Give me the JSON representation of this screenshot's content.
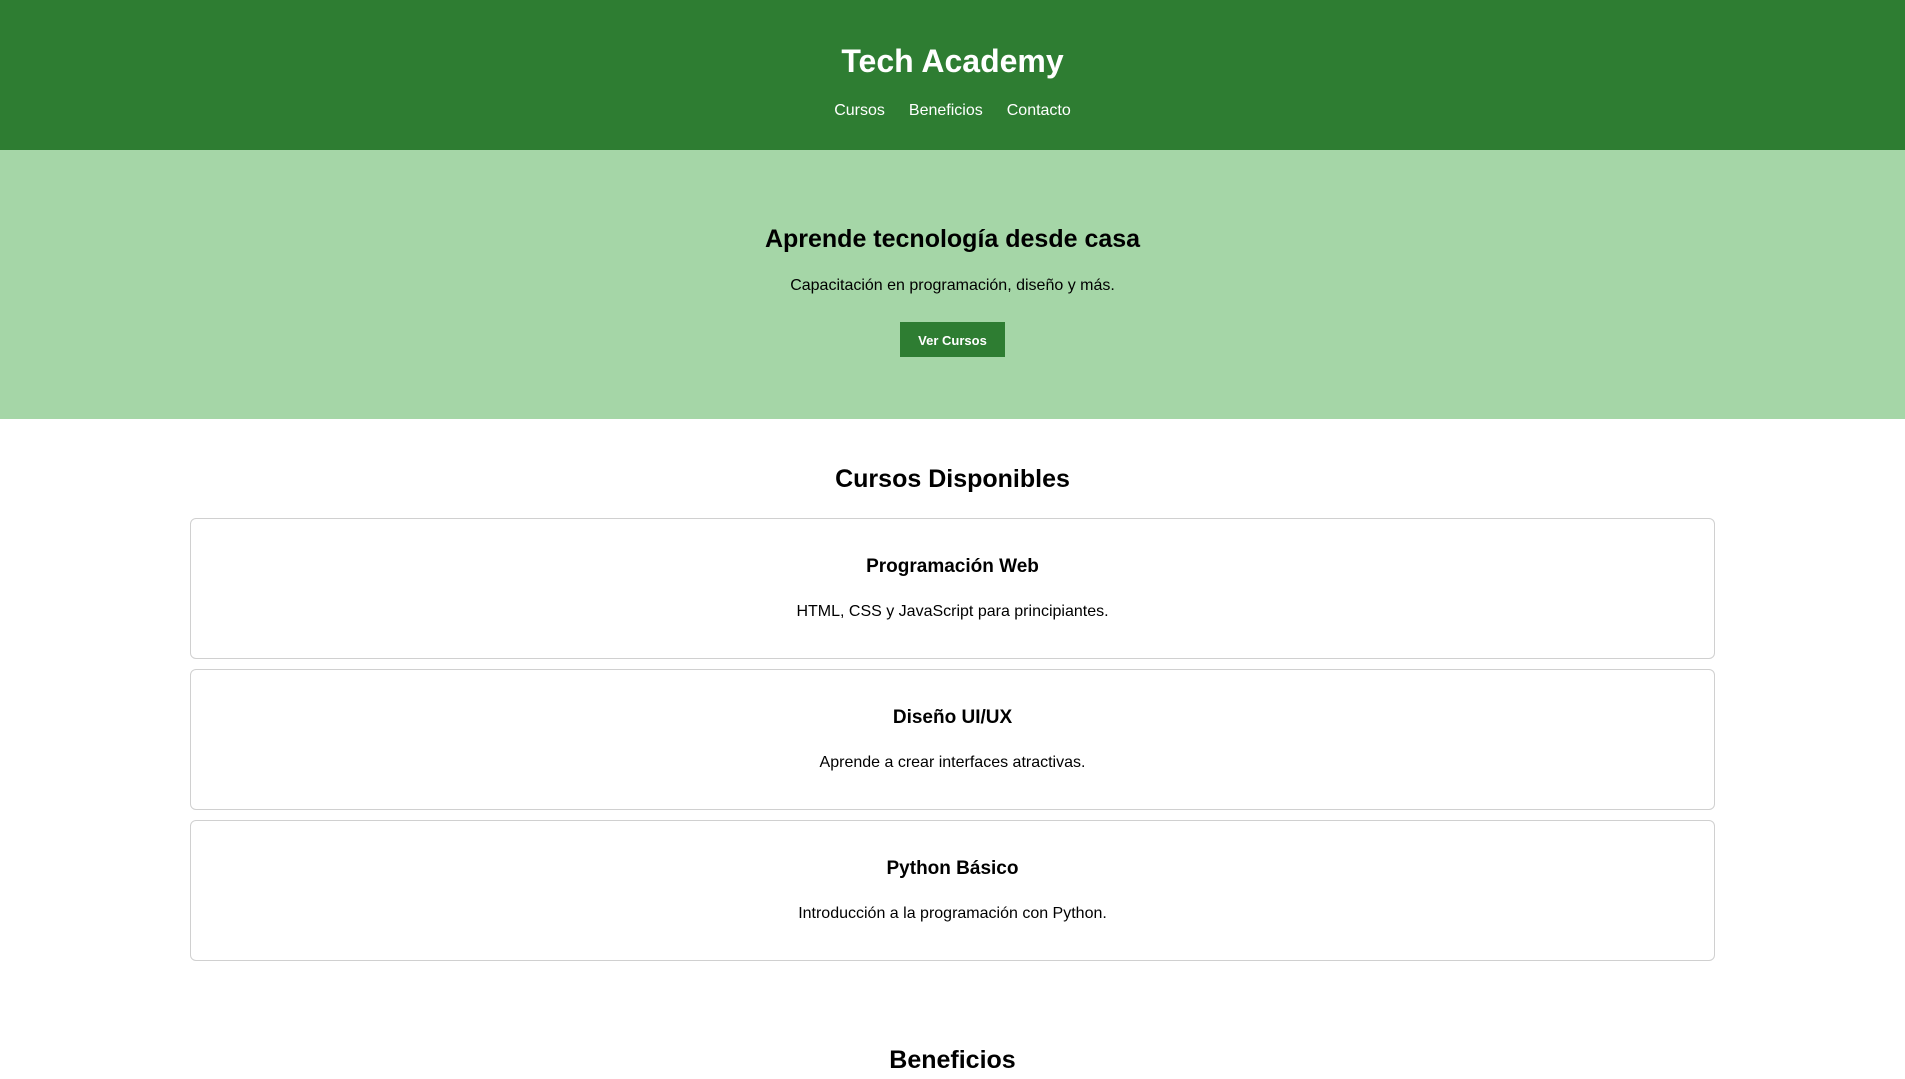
{
  "header": {
    "title": "Tech Academy",
    "nav": [
      {
        "label": "Cursos"
      },
      {
        "label": "Beneficios"
      },
      {
        "label": "Contacto"
      }
    ]
  },
  "hero": {
    "heading": "Aprende tecnología desde casa",
    "subtitle": "Capacitación en programación, diseño y más.",
    "button_label": "Ver Cursos"
  },
  "courses": {
    "heading": "Cursos Disponibles",
    "items": [
      {
        "title": "Programación Web",
        "description": "HTML, CSS y JavaScript para principiantes."
      },
      {
        "title": "Diseño UI/UX",
        "description": "Aprende a crear interfaces atractivas."
      },
      {
        "title": "Python Básico",
        "description": "Introducción a la programación con Python."
      }
    ]
  },
  "benefits": {
    "heading": "Beneficios"
  },
  "colors": {
    "primary": "#2e7d32",
    "hero_bg": "#a5d6a7",
    "card_border": "#d0d0d0"
  }
}
